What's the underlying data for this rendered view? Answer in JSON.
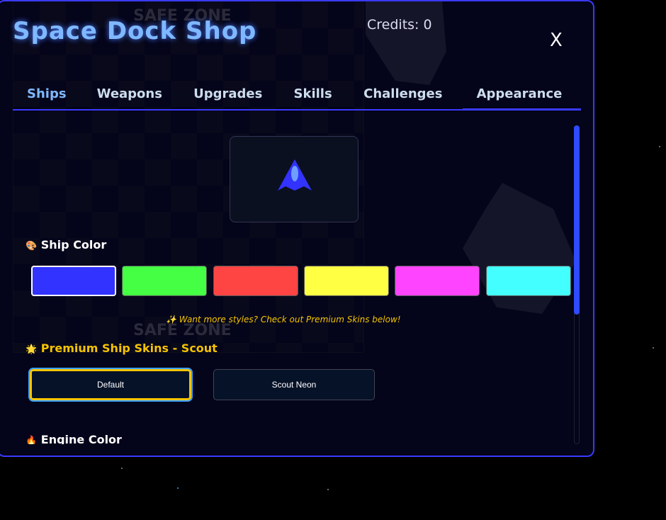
{
  "header": {
    "title": "Space Dock Shop",
    "credits": "Credits: 0",
    "close_label": "X"
  },
  "tabs": [
    {
      "label": "Ships"
    },
    {
      "label": "Weapons"
    },
    {
      "label": "Upgrades"
    },
    {
      "label": "Skills"
    },
    {
      "label": "Challenges"
    },
    {
      "label": "Appearance"
    }
  ],
  "background": {
    "safe_zone_label": "SAFE ZONE"
  },
  "ship_color": {
    "icon": "🎨",
    "label": "Ship Color",
    "swatches": [
      "#3333ff",
      "#44ff44",
      "#ff4444",
      "#ffff44",
      "#ff44ff",
      "#44ffff"
    ],
    "selected": 0
  },
  "hint": "✨ Want more styles? Check out Premium Skins below!",
  "premium": {
    "icon": "🌟",
    "label": "Premium Ship Skins - Scout",
    "skins": [
      {
        "label": "Default"
      },
      {
        "label": "Scout Neon"
      }
    ]
  },
  "engine": {
    "icon": "🔥",
    "label": "Engine Color"
  }
}
